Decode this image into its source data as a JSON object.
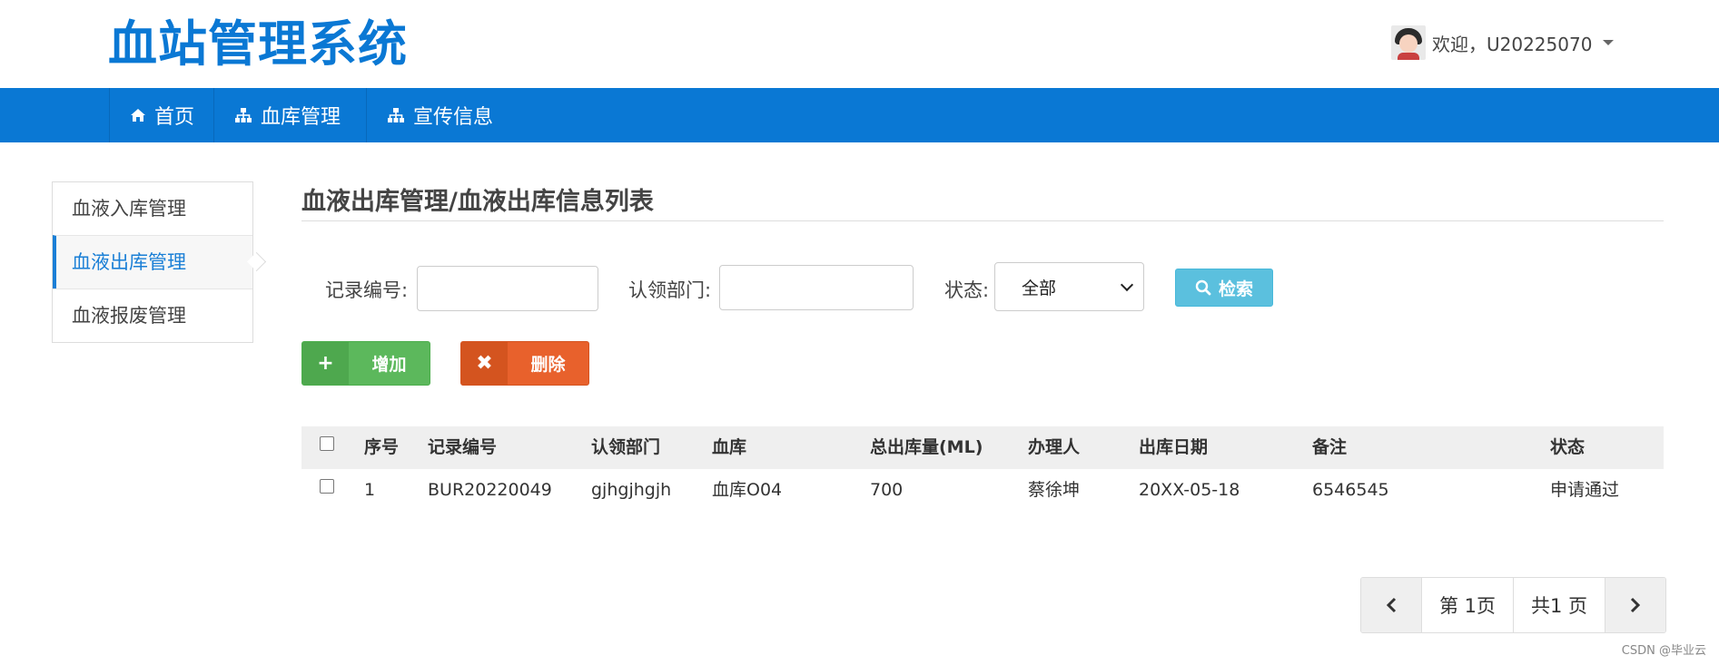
{
  "app": {
    "title": "血站管理系统",
    "user_greeting": "欢迎，U20225070"
  },
  "nav": {
    "items": [
      {
        "label": "首页",
        "icon": "home-icon"
      },
      {
        "label": "血库管理",
        "icon": "sitemap-icon"
      },
      {
        "label": "宣传信息",
        "icon": "sitemap-icon"
      }
    ]
  },
  "sidebar": {
    "items": [
      {
        "label": "血液入库管理",
        "active": false
      },
      {
        "label": "血液出库管理",
        "active": true
      },
      {
        "label": "血液报废管理",
        "active": false
      }
    ]
  },
  "page": {
    "title": "血液出库管理/血液出库信息列表"
  },
  "filters": {
    "record_no_label": "记录编号:",
    "record_no_value": "",
    "department_label": "认领部门:",
    "department_value": "",
    "status_label": "状态:",
    "status_value": "全部",
    "search_label": "检索"
  },
  "actions": {
    "add_label": "增加",
    "add_icon": "+",
    "delete_label": "删除",
    "delete_icon": "✖"
  },
  "table": {
    "headers": [
      "序号",
      "记录编号",
      "认领部门",
      "血库",
      "总出库量(ML)",
      "办理人",
      "出库日期",
      "备注",
      "状态"
    ],
    "rows": [
      [
        "1",
        "BUR20220049",
        "gjhgjhgjh",
        "血库O04",
        "700",
        "蔡徐坤",
        "20XX-05-18",
        "6546545",
        "申请通过"
      ]
    ]
  },
  "pager": {
    "current": "第 1页",
    "total": "共1 页"
  },
  "watermark": "CSDN @毕业云",
  "colors": {
    "brand": "#0a78d4",
    "add": "#5cb85c",
    "delete": "#e8612c",
    "search": "#5bc0de"
  }
}
